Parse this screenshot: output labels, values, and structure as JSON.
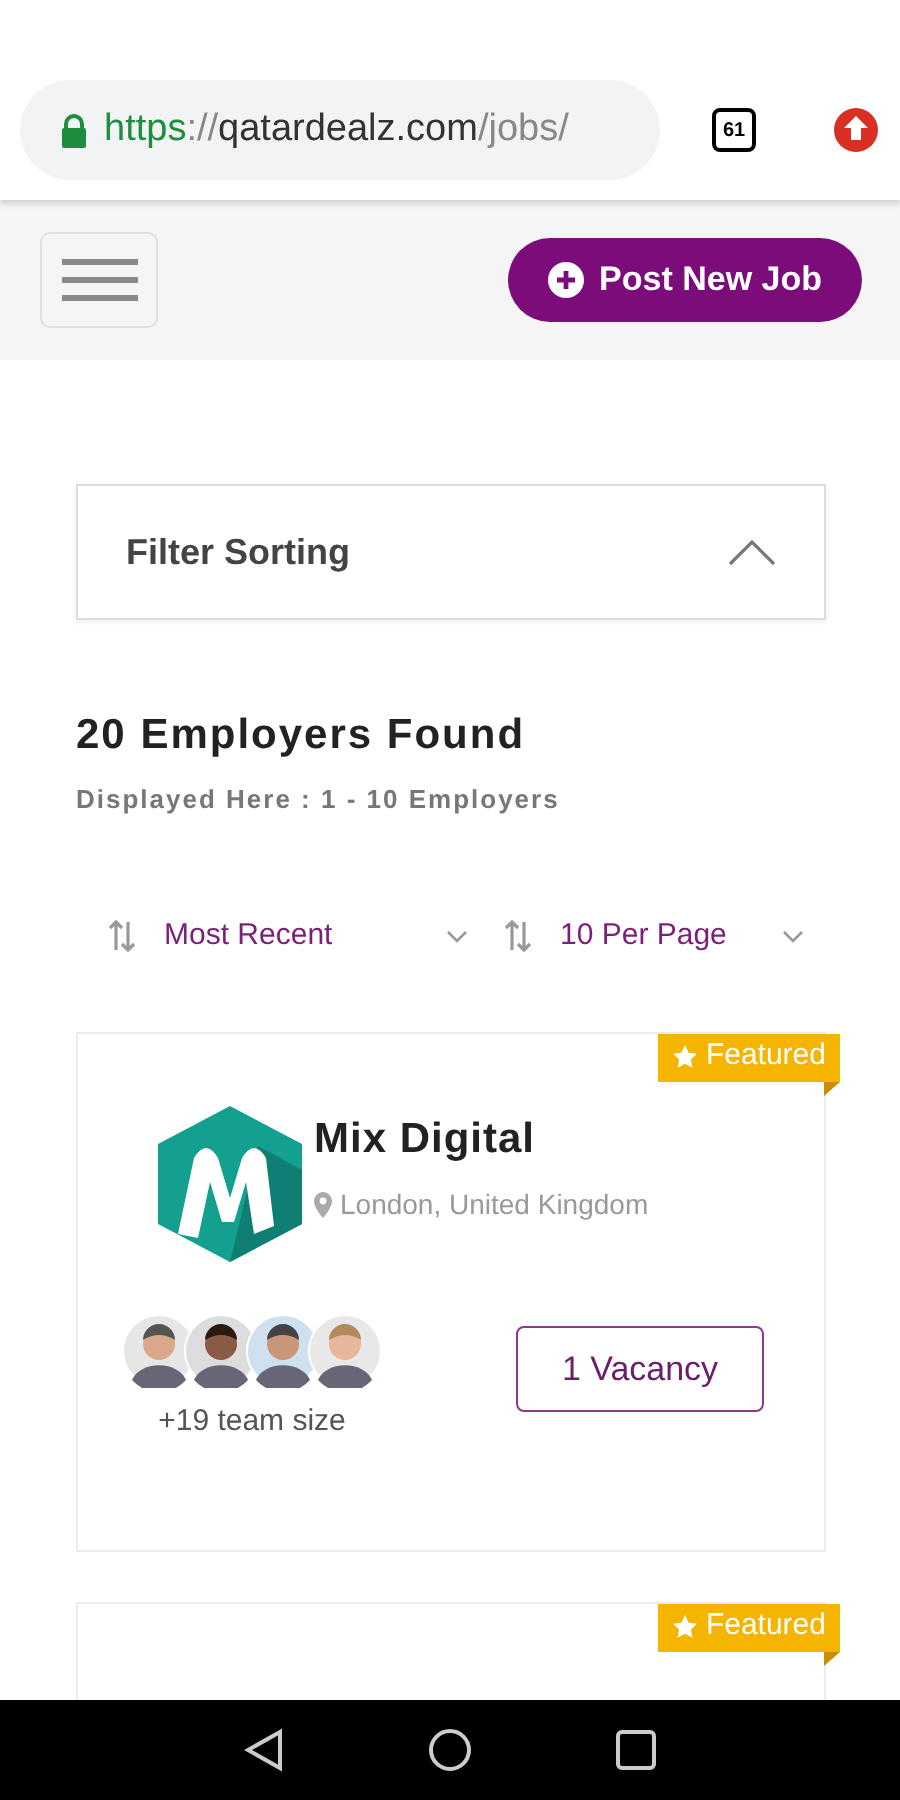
{
  "browser": {
    "url": [
      {
        "kind": "secure",
        "text": "https"
      },
      {
        "kind": "muted",
        "text": "://"
      },
      {
        "kind": "host",
        "text": "qatardealz.com"
      },
      {
        "kind": "muted",
        "text": "/jobs/"
      }
    ],
    "tab_count": "61"
  },
  "header": {
    "post_button": "Post New Job"
  },
  "filter": {
    "title": "Filter Sorting",
    "expanded": true
  },
  "results": {
    "title": "20 Employers Found",
    "subtitle": "Displayed Here : 1 - 10 Employers"
  },
  "sorting": [
    {
      "label": "Most Recent"
    },
    {
      "label": "10 Per Page"
    }
  ],
  "employers": [
    {
      "badge": "Featured",
      "name": "Mix Digital",
      "location": "London, United Kingdom",
      "team_size": "+19 team size",
      "vacancies": "1 Vacancy"
    },
    {
      "badge": "Featured"
    }
  ]
}
